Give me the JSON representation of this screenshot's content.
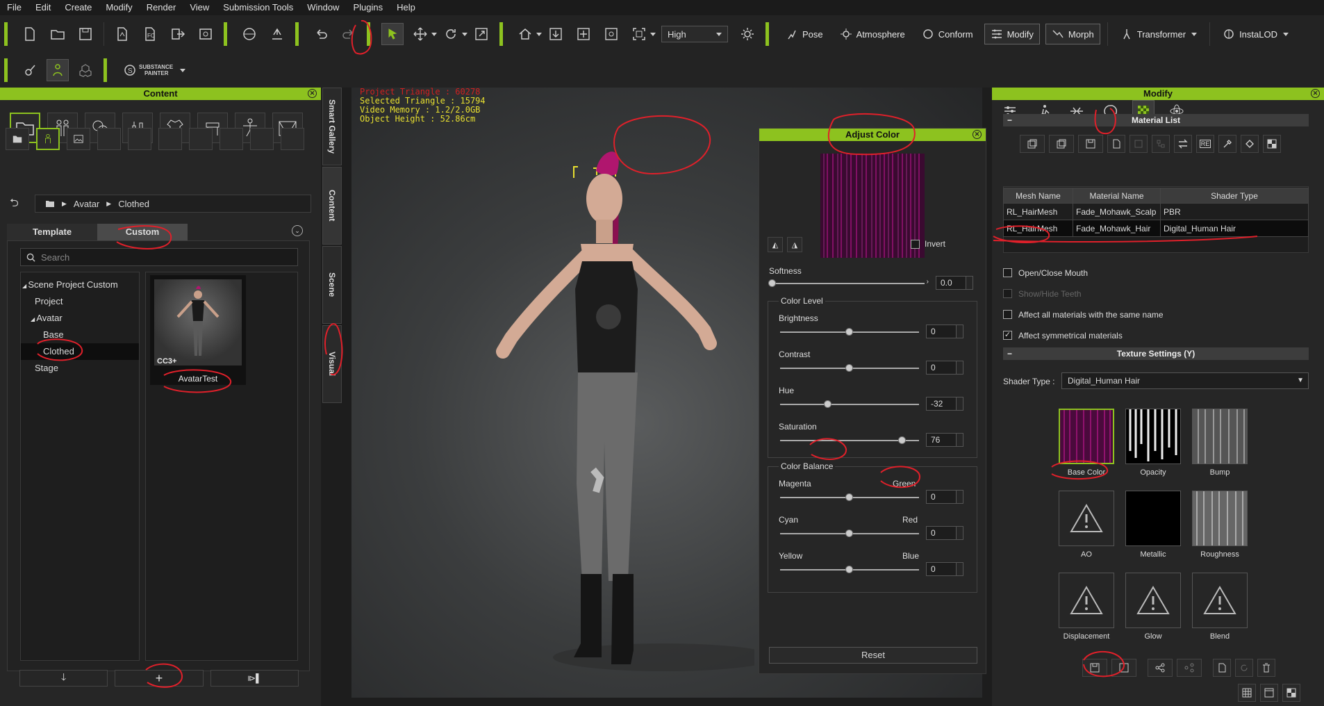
{
  "menu": [
    "File",
    "Edit",
    "Create",
    "Modify",
    "Render",
    "View",
    "Submission Tools",
    "Window",
    "Plugins",
    "Help"
  ],
  "toolbar": {
    "quality": "High",
    "pose": "Pose",
    "atmosphere": "Atmosphere",
    "conform": "Conform",
    "modify": "Modify",
    "morph": "Morph",
    "transformer": "Transformer",
    "instalod": "InstaLOD",
    "substance_line1": "SUBSTANCE",
    "substance_line2": "PAINTER"
  },
  "content_panel": {
    "title": "Content",
    "breadcrumb": [
      "Avatar",
      "Clothed"
    ],
    "tabs": [
      "Template",
      "Custom"
    ],
    "search_placeholder": "Search",
    "tree": [
      "Scene Project Custom",
      "Project",
      "Avatar",
      "Base",
      "Clothed",
      "Stage"
    ],
    "item_label": "AvatarTest",
    "item_badge": "CC3+",
    "side_tabs": [
      "Smart Gallery",
      "Content",
      "Scene",
      "Visual"
    ]
  },
  "viewport": {
    "stat_project": "Project Triangle : 60278",
    "stat_selected": "Selected Triangle : 15794",
    "stat_video": "Video Memory : 1.2/2.0GB",
    "stat_height": "Object Height : 52.86cm"
  },
  "adjust_color": {
    "title": "Adjust Color",
    "invert": "Invert",
    "softness_label": "Softness",
    "softness": "0.0",
    "color_level": "Color Level",
    "brightness_label": "Brightness",
    "brightness": "0",
    "contrast_label": "Contrast",
    "contrast": "0",
    "hue_label": "Hue",
    "hue": "-32",
    "saturation_label": "Saturation",
    "saturation": "76",
    "color_balance": "Color Balance",
    "magenta": "Magenta",
    "green": "Green",
    "mg": "0",
    "cyan": "Cyan",
    "red": "Red",
    "cr": "0",
    "yellow": "Yellow",
    "blue": "Blue",
    "yb": "0",
    "reset": "Reset"
  },
  "modify_panel": {
    "title": "Modify",
    "material_list": "Material List",
    "columns": [
      "Mesh Name",
      "Material Name",
      "Shader Type"
    ],
    "rows": [
      [
        "RL_HairMesh",
        "Fade_Mohawk_Scalp",
        "PBR"
      ],
      [
        "RL_HairMesh",
        "Fade_Mohawk_Hair",
        "Digital_Human Hair"
      ]
    ],
    "open_close_mouth": "Open/Close Mouth",
    "show_hide_teeth": "Show/Hide Teeth",
    "affect_same_name": "Affect all materials with the same name",
    "affect_symmetrical": "Affect symmetrical materials",
    "texture_settings": "Texture Settings  (Y)",
    "shader_type_label": "Shader Type :",
    "shader_type": "Digital_Human Hair",
    "textures": [
      "Base Color",
      "Opacity",
      "Bump",
      "AO",
      "Metallic",
      "Roughness",
      "Displacement",
      "Glow",
      "Blend"
    ]
  },
  "colors": {
    "accent": "#8dc21f",
    "annotation": "#e0202a",
    "stats_red": "#d02020",
    "stats_yellow": "#e8e030"
  }
}
